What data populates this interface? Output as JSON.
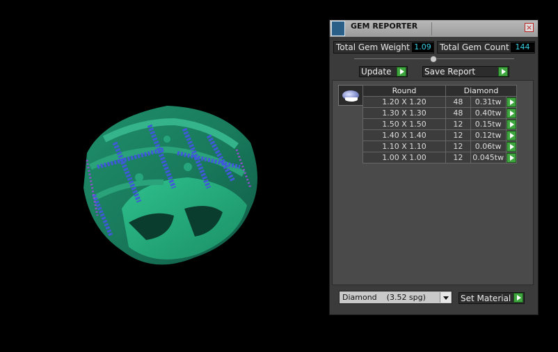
{
  "panel": {
    "title": "GEM REPORTER",
    "close_label": "×",
    "total_weight_label": "Total Gem Weight",
    "total_weight_value": "1.09",
    "total_count_label": "Total Gem Count",
    "total_count_value": "144",
    "update_label": "Update",
    "save_report_label": "Save Report"
  },
  "table": {
    "headers": [
      "Round",
      "Diamond"
    ],
    "rows": [
      {
        "size": "1.20 X 1.20",
        "count": "48",
        "weight": "0.31tw"
      },
      {
        "size": "1.30 X 1.30",
        "count": "48",
        "weight": "0.40tw"
      },
      {
        "size": "1.50 X 1.50",
        "count": "12",
        "weight": "0.15tw"
      },
      {
        "size": "1.40 X 1.40",
        "count": "12",
        "weight": "0.12tw"
      },
      {
        "size": "1.10 X 1.10",
        "count": "12",
        "weight": "0.06tw"
      },
      {
        "size": "1.00 X 1.00",
        "count": "12",
        "weight": "0.045tw"
      }
    ]
  },
  "material": {
    "selected": "Diamond    (3.52 spg)",
    "set_label": "Set Material"
  }
}
